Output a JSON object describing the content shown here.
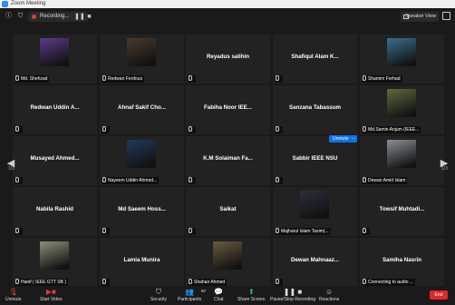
{
  "window": {
    "title": "Zoom Meeting"
  },
  "topbar": {
    "recording_label": "Recording...",
    "view_label": "Speaker View"
  },
  "tiles": [
    {
      "name": "",
      "label": "Md. Shehzad",
      "photo": "#5b3b8a"
    },
    {
      "name": "",
      "label": "Redwan Ferdous",
      "photo": "#4a3a2e"
    },
    {
      "name": "Reyadus salihin",
      "label": ""
    },
    {
      "name": "Shafiqul  Alam  K...",
      "label": ""
    },
    {
      "name": "",
      "label": "Shamim Forhad",
      "photo": "#3c6f8f"
    },
    {
      "name": "Redwan  Uddin  A...",
      "label": ""
    },
    {
      "name": "Ahnaf  Sakif  Cho...",
      "label": ""
    },
    {
      "name": "Fabiha  Noor  IEE...",
      "label": ""
    },
    {
      "name": "Sanzana  Tabassum",
      "label": ""
    },
    {
      "name": "",
      "label": "Md.Samin Anjum (IEEE...",
      "photo": "#5d6b3e"
    },
    {
      "name": "Musayed  Ahmed...",
      "label": ""
    },
    {
      "name": "",
      "label": "Nayeem Uddin Ahmed...",
      "photo": "#203a5a"
    },
    {
      "name": "K.M  Solaiman  Fa...",
      "label": ""
    },
    {
      "name": "Sabbir  IEEE  NSU",
      "label": ""
    },
    {
      "name": "",
      "label": "Dewan Amid Islam",
      "photo": "#8a8f96"
    },
    {
      "name": "Nabila  Rashid",
      "label": ""
    },
    {
      "name": "Md  Saeem  Hoss...",
      "label": ""
    },
    {
      "name": "Saikat",
      "label": ""
    },
    {
      "name": "",
      "label": "Majharul Islam Tasim(...",
      "photo": "#2a2f3a"
    },
    {
      "name": "Towsif  Muhtadi...",
      "label": ""
    },
    {
      "name": "",
      "label": "Hanif ( IEEE GTT SB )",
      "photo": "#8d8f7a"
    },
    {
      "name": "Lamia  Munira",
      "label": ""
    },
    {
      "name": "",
      "label": "Shahan Ahmed",
      "photo": "#6a5a3f"
    },
    {
      "name": "Dewan  Mahnaaz...",
      "label": ""
    },
    {
      "name": "Samiha  Nasrin",
      "label": "Connecting to audio ..."
    }
  ],
  "pagination": {
    "left": "1/3",
    "right": "1/3"
  },
  "popover": {
    "unmute_label": "Unmute",
    "more": "···"
  },
  "toolbar": {
    "unmute": "Unmute",
    "start_video": "Start Video",
    "security": "Security",
    "participants": "Participants",
    "participants_count": "67",
    "chat": "Chat",
    "share_screen": "Share Screen",
    "record": "Pause/Stop Recording",
    "reactions": "Reactions",
    "end": "End"
  },
  "colors": {
    "accent": "#0e71eb",
    "end": "#e02828",
    "share": "#22c55e",
    "rec": "#e23b3b"
  }
}
